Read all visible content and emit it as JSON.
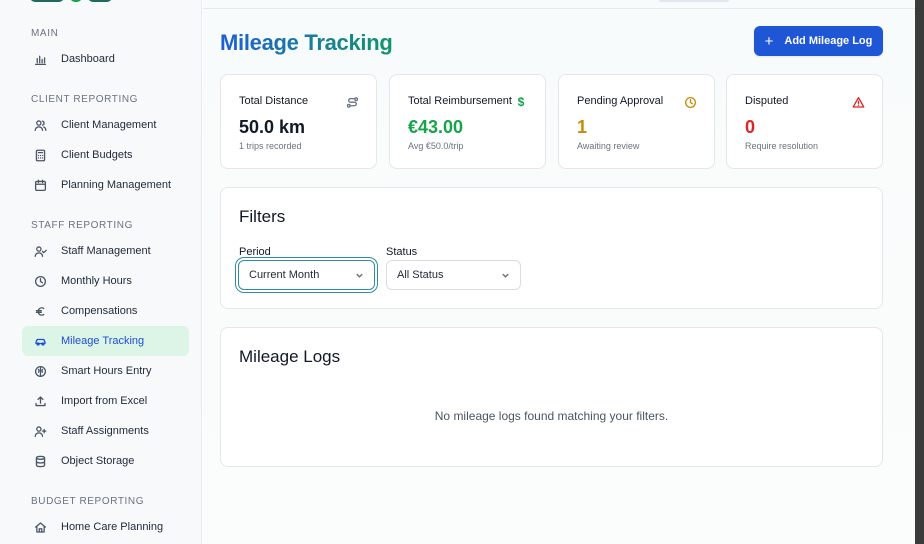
{
  "sidebar": {
    "sections": [
      {
        "label": "MAIN",
        "items": [
          {
            "label": "Dashboard",
            "icon": "bar-chart-icon"
          }
        ]
      },
      {
        "label": "CLIENT REPORTING",
        "items": [
          {
            "label": "Client Management",
            "icon": "users-icon"
          },
          {
            "label": "Client Budgets",
            "icon": "calculator-icon"
          },
          {
            "label": "Planning Management",
            "icon": "calendar-icon"
          }
        ]
      },
      {
        "label": "STAFF REPORTING",
        "items": [
          {
            "label": "Staff Management",
            "icon": "user-check-icon"
          },
          {
            "label": "Monthly Hours",
            "icon": "clock-icon"
          },
          {
            "label": "Compensations",
            "icon": "euro-icon"
          },
          {
            "label": "Mileage Tracking",
            "icon": "car-icon",
            "active": true
          },
          {
            "label": "Smart Hours Entry",
            "icon": "brain-icon"
          },
          {
            "label": "Import from Excel",
            "icon": "upload-icon"
          },
          {
            "label": "Staff Assignments",
            "icon": "user-plus-icon"
          },
          {
            "label": "Object Storage",
            "icon": "database-icon"
          }
        ]
      },
      {
        "label": "BUDGET REPORTING",
        "items": [
          {
            "label": "Home Care Planning",
            "icon": "home-icon"
          }
        ]
      }
    ]
  },
  "page": {
    "title": "Mileage Tracking",
    "add_button_label": "Add Mileage Log"
  },
  "stats": [
    {
      "title": "Total Distance",
      "value": "50.0 km",
      "sub": "1 trips recorded",
      "icon": "route-icon",
      "color": "#111827"
    },
    {
      "title": "Total Reimbursement",
      "value": "€43.00",
      "sub": "Avg €50.0/trip",
      "icon": "dollar-icon",
      "color": "#16a34a"
    },
    {
      "title": "Pending Approval",
      "value": "1",
      "sub": "Awaiting review",
      "icon": "clock-icon",
      "color": "#ca8a04"
    },
    {
      "title": "Disputed",
      "value": "0",
      "sub": "Require resolution",
      "icon": "alert-triangle-icon",
      "color": "#dc2626"
    }
  ],
  "filters": {
    "title": "Filters",
    "period_label": "Period",
    "period_value": "Current Month",
    "status_label": "Status",
    "status_value": "All Status"
  },
  "logs": {
    "title": "Mileage Logs",
    "empty_message": "No mileage logs found matching your filters."
  },
  "colors": {
    "accent": "#1f56d6",
    "active_nav_bg": "#dcf5e6",
    "title_gradient_start": "#1d5fd6",
    "title_gradient_end": "#12966a"
  }
}
